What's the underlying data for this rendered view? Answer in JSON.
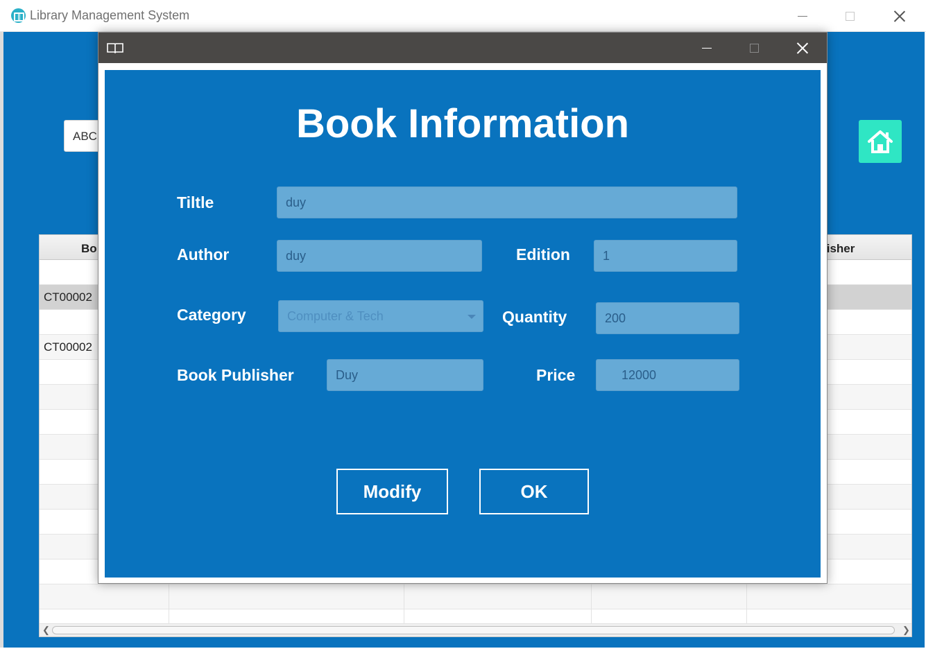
{
  "main_window": {
    "title": "Library Management System",
    "search_value": "ABC",
    "table": {
      "visible_headers": [
        "Bo",
        "lisher"
      ],
      "rows": [
        {
          "id": ""
        },
        {
          "id": "CT00002"
        },
        {
          "id": ""
        },
        {
          "id": "CT00002"
        }
      ]
    }
  },
  "dialog": {
    "heading": "Book Information",
    "fields": {
      "title_label": "Tiltle",
      "title_value": "duy",
      "author_label": "Author",
      "author_value": "duy",
      "edition_label": "Edition",
      "edition_value": "1",
      "category_label": "Category",
      "category_value": "Computer & Tech",
      "quantity_label": "Quantity",
      "quantity_value": "200",
      "publisher_label": "Book Publisher",
      "publisher_value": "Duy",
      "price_label": "Price",
      "price_value": "12000"
    },
    "buttons": {
      "modify": "Modify",
      "ok": "OK"
    }
  },
  "icons": {
    "app": "book-circle-icon",
    "dialog": "open-book-icon",
    "home": "home-icon"
  },
  "colors": {
    "panel_blue": "#0973be",
    "field_blue": "#66aad6",
    "home_button": "#2fe6c4",
    "dialog_titlebar": "#4a4846"
  }
}
